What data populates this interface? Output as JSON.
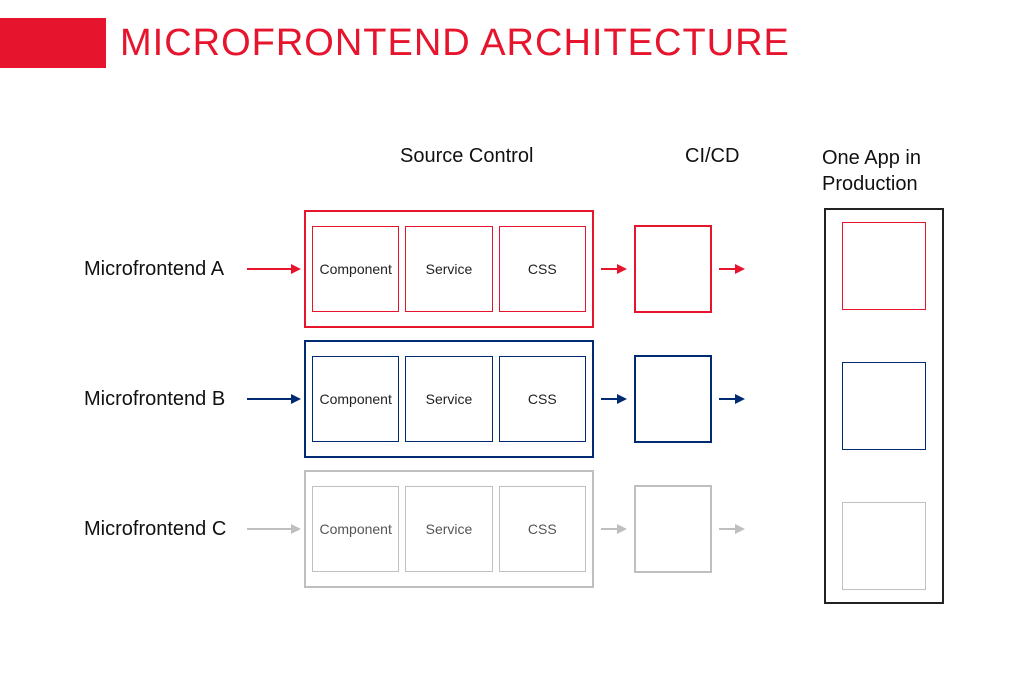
{
  "title": "MICROFRONTEND ARCHITECTURE",
  "columns": {
    "source": "Source Control",
    "cicd": "CI/CD",
    "prod": "One App in Production"
  },
  "rows": [
    {
      "label": "Microfrontend A",
      "color": "#e6152d",
      "boxes": [
        "Component",
        "Service",
        "CSS"
      ]
    },
    {
      "label": "Microfrontend B",
      "color": "#002a72",
      "boxes": [
        "Component",
        "Service",
        "CSS"
      ]
    },
    {
      "label": "Microfrontend C",
      "color": "#bfbfbf",
      "boxes": [
        "Component",
        "Service",
        "CSS"
      ]
    }
  ],
  "colors": {
    "accent": "#e6152d",
    "red": "#e6152d",
    "blue": "#002a72",
    "gray": "#bfbfbf",
    "black": "#222222"
  }
}
